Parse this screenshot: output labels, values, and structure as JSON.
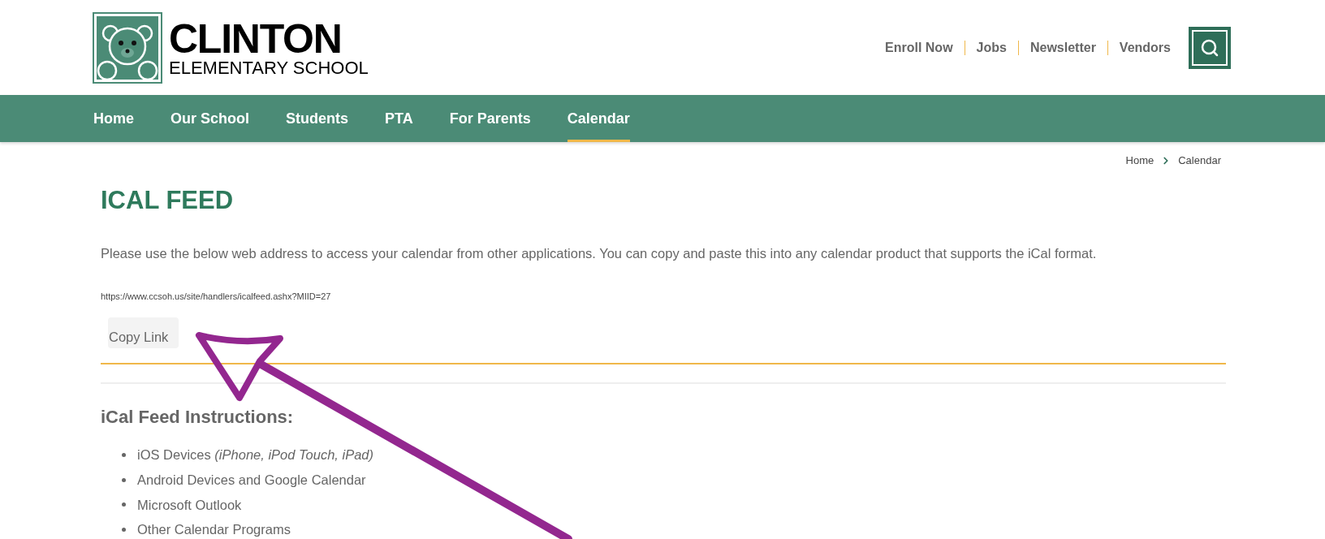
{
  "header": {
    "logo": {
      "name": "CLINTON",
      "subtitle": "ELEMENTARY SCHOOL"
    },
    "utility_links": [
      "Enroll Now",
      "Jobs",
      "Newsletter",
      "Vendors"
    ]
  },
  "nav": [
    {
      "label": "Home",
      "selected": false
    },
    {
      "label": "Our School",
      "selected": false
    },
    {
      "label": "Students",
      "selected": false
    },
    {
      "label": "PTA",
      "selected": false
    },
    {
      "label": "For Parents",
      "selected": false
    },
    {
      "label": "Calendar",
      "selected": true
    }
  ],
  "breadcrumb": [
    "Home",
    "Calendar"
  ],
  "page": {
    "title": "ICAL FEED",
    "intro": "Please use the below web address to access your calendar from other applications. You can copy and paste this into any calendar product that supports the iCal format.",
    "feed_url": "https://www.ccsoh.us/site/handlers/icalfeed.ashx?MIID=27",
    "copy_button": "Copy Link",
    "instructions_title": "iCal Feed Instructions:",
    "instructions": [
      "iOS Devices *(iPhone, iPod Touch, iPad)*",
      "Android Devices and Google Calendar",
      "Microsoft Outlook",
      "Other Calendar Programs"
    ]
  }
}
